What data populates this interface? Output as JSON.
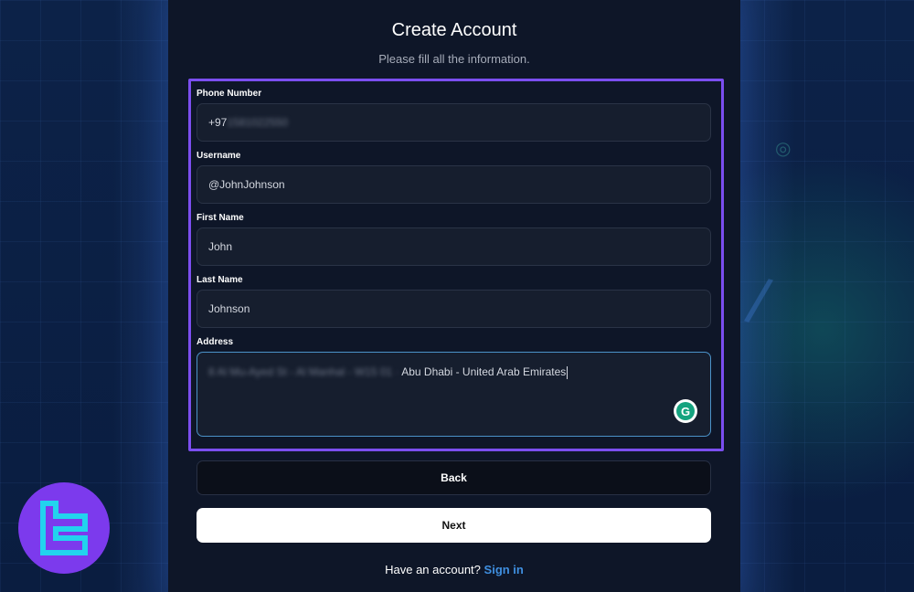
{
  "page": {
    "title": "Create Account",
    "subtitle": "Please fill all the information."
  },
  "form": {
    "phone": {
      "label": "Phone Number",
      "value_visible": "+97",
      "value_blurred": "1581022550"
    },
    "username": {
      "label": "Username",
      "value": "@JohnJohnson"
    },
    "first_name": {
      "label": "First Name",
      "value": "John"
    },
    "last_name": {
      "label": "Last Name",
      "value": "Johnson"
    },
    "address": {
      "label": "Address",
      "value_blurred": "8 Al Mu-Ayed St - Al Manhal - W15 01 ·",
      "value_visible": "Abu Dhabi - United Arab Emirates"
    }
  },
  "buttons": {
    "back": "Back",
    "next": "Next"
  },
  "footer": {
    "prompt": "Have an account?",
    "link": "Sign in"
  },
  "grammarly": {
    "icon": "grammarly-icon",
    "letter": "G"
  },
  "colors": {
    "highlight": "#7b4ef0",
    "link": "#3f8fe0",
    "logo": "#7c3aed",
    "logo_mark": "#22d3ee"
  }
}
